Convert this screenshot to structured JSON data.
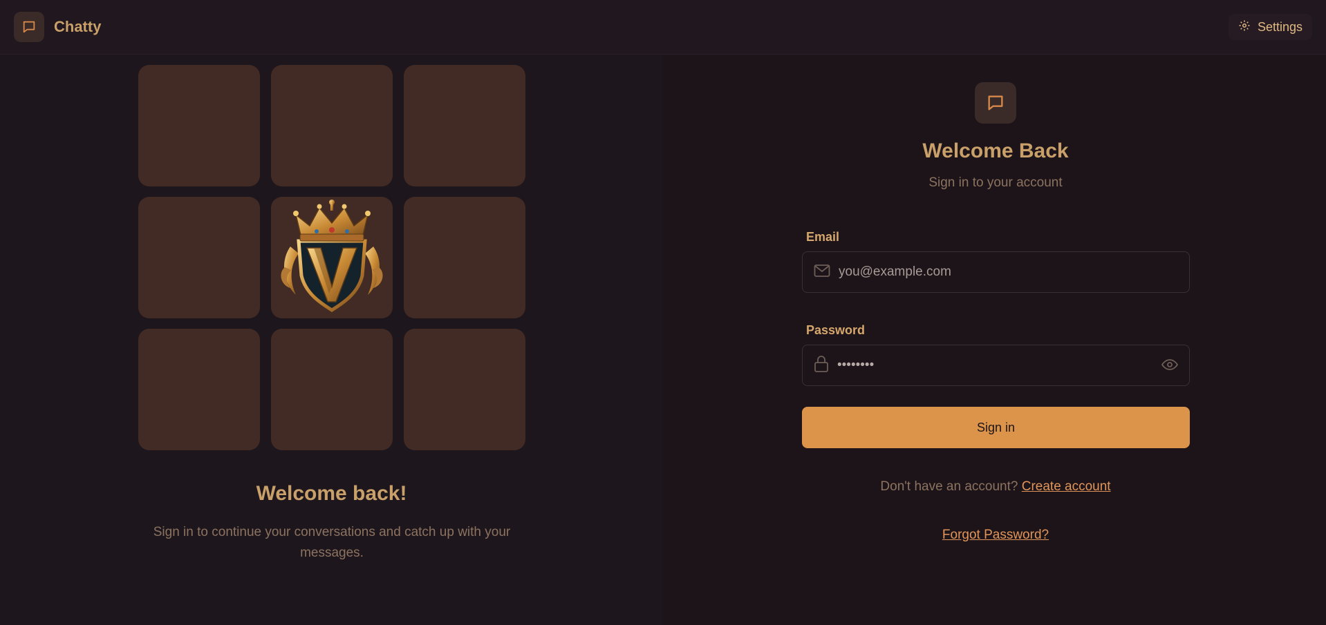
{
  "header": {
    "brand_name": "Chatty",
    "settings_label": "Settings"
  },
  "left_panel": {
    "title": "Welcome back!",
    "subtitle": "Sign in to continue your conversations and catch up with your messages.",
    "tile_count": 9,
    "center_tile_image": "crown-v-crest-icon"
  },
  "login": {
    "title": "Welcome Back",
    "subtitle": "Sign in to your account",
    "email_label": "Email",
    "email_placeholder": "you@example.com",
    "email_value": "",
    "password_label": "Password",
    "password_value": "••••••••",
    "sign_in_label": "Sign in",
    "no_account_text": "Don't have an account?",
    "create_account_label": "Create account",
    "forgot_password_label": "Forgot Password?"
  },
  "colors": {
    "background": "#1e161d",
    "accent": "#dc934a",
    "text_gold": "#c9a06a",
    "tile": "#432b25",
    "muted": "#8c7360"
  }
}
